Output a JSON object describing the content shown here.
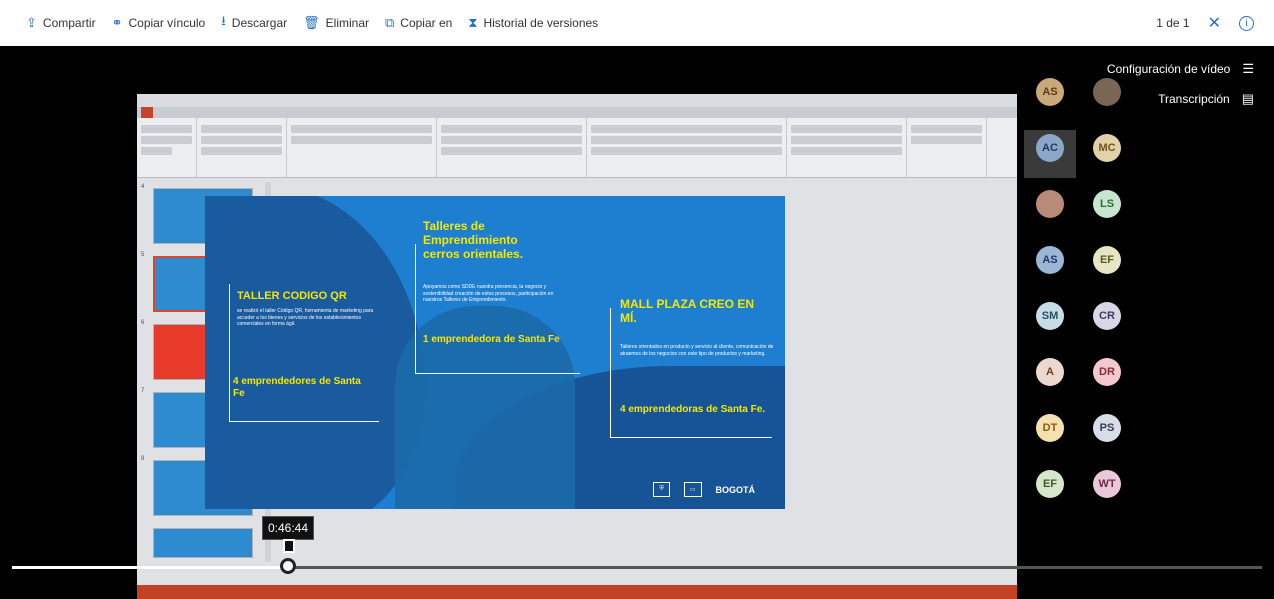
{
  "toolbar": {
    "items": [
      {
        "label": "Compartir",
        "icon": "share-icon"
      },
      {
        "label": "Copiar vínculo",
        "icon": "link-icon"
      },
      {
        "label": "Descargar",
        "icon": "download-icon"
      },
      {
        "label": "Eliminar",
        "icon": "trash-icon"
      },
      {
        "label": "Copiar en",
        "icon": "copy-icon"
      },
      {
        "label": "Historial de versiones",
        "icon": "history-icon"
      }
    ],
    "page_count": "1 de 1"
  },
  "video_menu": {
    "settings": "Configuración de vídeo",
    "transcript": "Transcripción"
  },
  "slide": {
    "block1_title": "TALLER CODIGO QR",
    "block1_text": "se realizó el taller Código QR, herramienta de marketing para acceder a los bienes y servicios de los establecimientos comerciales en forma ágil.",
    "block1_result": "4 emprendedores de Santa Fe",
    "block2_title": "Talleres de Emprendimiento cerros orientales.",
    "block2_text": "Apoyamos como SDDE nuestra presencia, la negocio y sostenibilidad creación de estos procesos, participación en nuestros Talleres de Emprendimiento.",
    "block2_result": "1 emprendedora de Santa Fe",
    "block3_title": "MALL PLAZA CREO EN MÍ.",
    "block3_text": "Talleres orientados en producto y servicio al cliente, comunicación de atraemos de los negocios con este tipo de productos y marketing.",
    "block3_result": "4 emprendedoras de Santa Fe.",
    "logo_text": "BOGOTÁ"
  },
  "participants": [
    {
      "initials": "AS",
      "color": "#c9a97a",
      "fg": "#5a3d1a"
    },
    {
      "initials": "",
      "color": "#7a6656",
      "fg": "#fff"
    },
    {
      "initials": "AC",
      "color": "#8aa6c9",
      "fg": "#1d3a66"
    },
    {
      "initials": "MC",
      "color": "#e3d2a8",
      "fg": "#6a5424"
    },
    {
      "initials": "",
      "color": "#b98a78",
      "fg": "#fff"
    },
    {
      "initials": "LS",
      "color": "#c8e6cf",
      "fg": "#2d6a3f"
    },
    {
      "initials": "AS",
      "color": "#9cb6d8",
      "fg": "#1d3a66"
    },
    {
      "initials": "EF",
      "color": "#e5e6c3",
      "fg": "#5b5c25"
    },
    {
      "initials": "SM",
      "color": "#c7dde6",
      "fg": "#245264"
    },
    {
      "initials": "CR",
      "color": "#d9d7e6",
      "fg": "#41395f"
    },
    {
      "initials": "A",
      "color": "#ecd8cc",
      "fg": "#6b3f2a"
    },
    {
      "initials": "DR",
      "color": "#f2c9cf",
      "fg": "#8a2a3a"
    },
    {
      "initials": "DT",
      "color": "#f5e1b0",
      "fg": "#8a5a12"
    },
    {
      "initials": "PS",
      "color": "#d8dde8",
      "fg": "#333d55"
    },
    {
      "initials": "EF",
      "color": "#d5e6c9",
      "fg": "#3e5c2c"
    },
    {
      "initials": "WT",
      "color": "#e9c9d8",
      "fg": "#6b2a4a"
    }
  ],
  "timeline": {
    "current_time": "0:46:44",
    "progress": 0.221
  },
  "colors": {
    "accent": "#2a6fc9",
    "slide_bg": "#1e7fd0",
    "highlight": "#f4e800"
  }
}
